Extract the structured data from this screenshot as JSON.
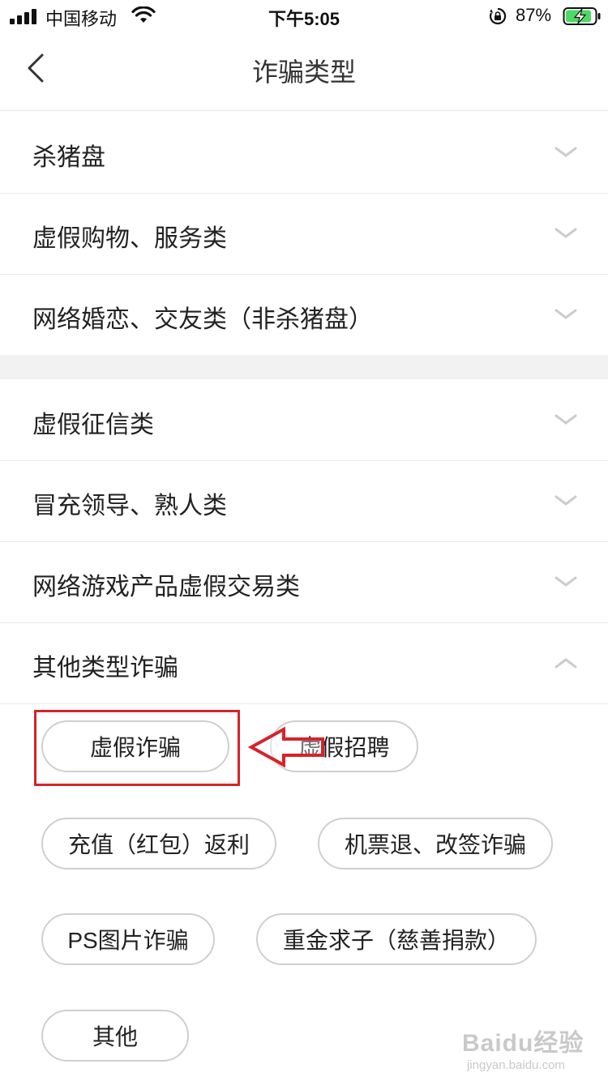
{
  "status_bar": {
    "carrier": "中国移动",
    "time": "下午5:05",
    "battery_percent": "87%"
  },
  "nav": {
    "title": "诈骗类型"
  },
  "categories": [
    {
      "label": "杀猪盘",
      "expanded": false
    },
    {
      "label": "虚假购物、服务类",
      "expanded": false
    },
    {
      "label": "网络婚恋、交友类（非杀猪盘）",
      "expanded": false
    },
    {
      "label": "虚假征信类",
      "expanded": false
    },
    {
      "label": "冒充领导、熟人类",
      "expanded": false
    },
    {
      "label": "网络游戏产品虚假交易类",
      "expanded": false
    },
    {
      "label": "其他类型诈骗",
      "expanded": true
    }
  ],
  "subtypes": [
    "虚假诈骗",
    "虚假招聘",
    "充值（红包）返利",
    "机票退、改签诈骗",
    "PS图片诈骗",
    "重金求子（慈善捐款）",
    "其他"
  ],
  "annotation": {
    "highlight_color": "#d6232b"
  },
  "watermark": {
    "logo": "Baidu经验",
    "url": "jingyan.baidu.com"
  }
}
